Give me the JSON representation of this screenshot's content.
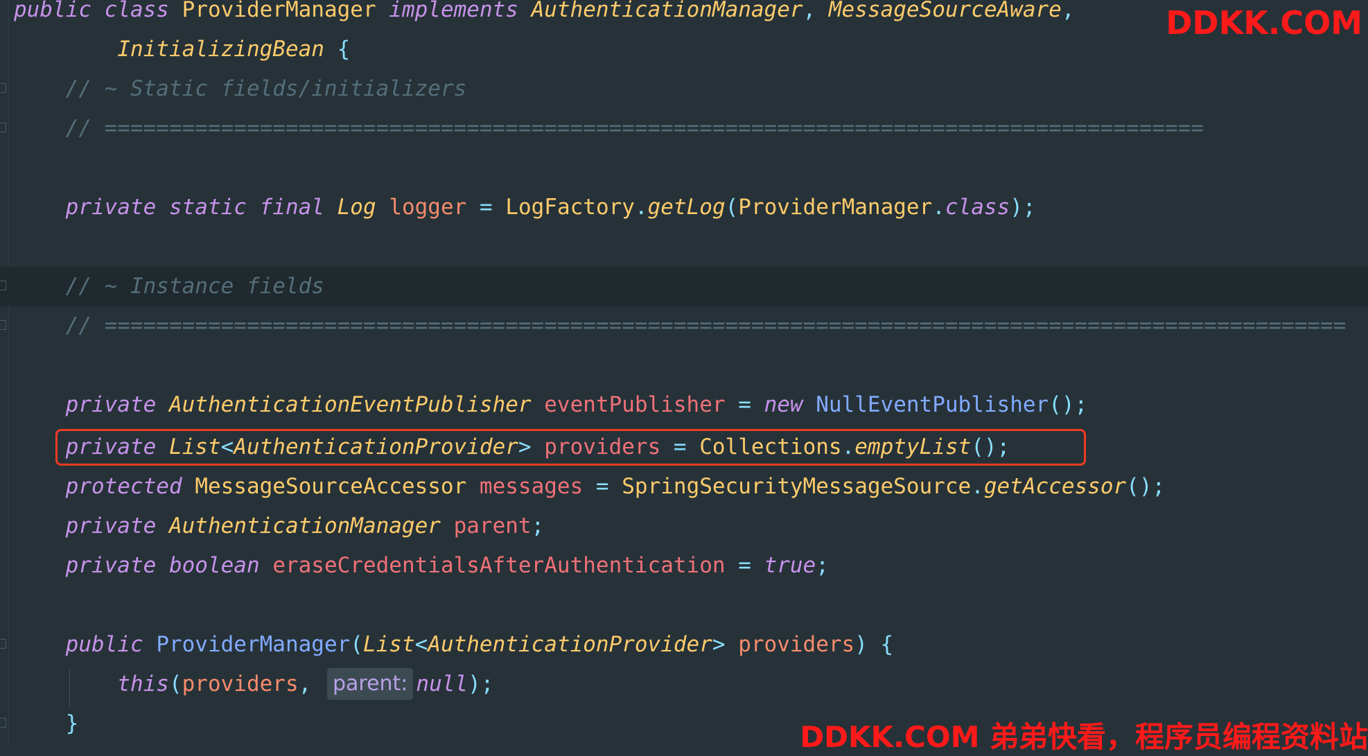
{
  "watermarks": {
    "top": "DDKK.COM",
    "bottom": "DDKK.COM 弟弟快看，程序员编程资料站"
  },
  "editor": {
    "inlay_hint": "parent:",
    "highlighted_line": 12,
    "colors": {
      "background": "#263238",
      "current_line": "#1f292e",
      "highlight_box": "#f03c24",
      "keyword": "#c792ea",
      "type": "#ffcb6b",
      "field": "#f07178",
      "comment": "#546e7a"
    }
  },
  "code": {
    "l1": {
      "kw1": "public",
      "kw2": "class",
      "cls": "ProviderManager",
      "kw3": "implements",
      "i1": "AuthenticationManager",
      "i2": "MessageSourceAware"
    },
    "l2": {
      "i3": "InitializingBean"
    },
    "l3": {
      "comment": "// ~ Static fields/initializers"
    },
    "l4": {
      "comment": "// ====================================================================================="
    },
    "l6": {
      "kw1": "private",
      "kw2": "static",
      "kw3": "final",
      "type": "Log",
      "name": "logger",
      "cls": "LogFactory",
      "method": "getLog",
      "arg": "ProviderManager",
      "kw4": "class"
    },
    "l8": {
      "comment": "// ~ Instance fields"
    },
    "l9": {
      "comment": "// ================================================================================================"
    },
    "l11": {
      "kw1": "private",
      "type": "AuthenticationEventPublisher",
      "name": "eventPublisher",
      "kw2": "new",
      "cls": "NullEventPublisher"
    },
    "l12": {
      "kw1": "private",
      "type": "List",
      "generic": "AuthenticationProvider",
      "name": "providers",
      "cls": "Collections",
      "method": "emptyList"
    },
    "l13": {
      "kw1": "protected",
      "type": "MessageSourceAccessor",
      "name": "messages",
      "cls": "SpringSecurityMessageSource",
      "method": "getAccessor"
    },
    "l14": {
      "kw1": "private",
      "type": "AuthenticationManager",
      "name": "parent"
    },
    "l15": {
      "kw1": "private",
      "type": "boolean",
      "name": "eraseCredentialsAfterAuthentication",
      "value": "true"
    },
    "l17": {
      "kw1": "public",
      "ctor": "ProviderManager",
      "ptype": "List",
      "generic": "AuthenticationProvider",
      "pname": "providers"
    },
    "l18": {
      "kw1": "this",
      "arg": "providers",
      "value": "null"
    },
    "l19": {
      "brace": "}"
    }
  }
}
